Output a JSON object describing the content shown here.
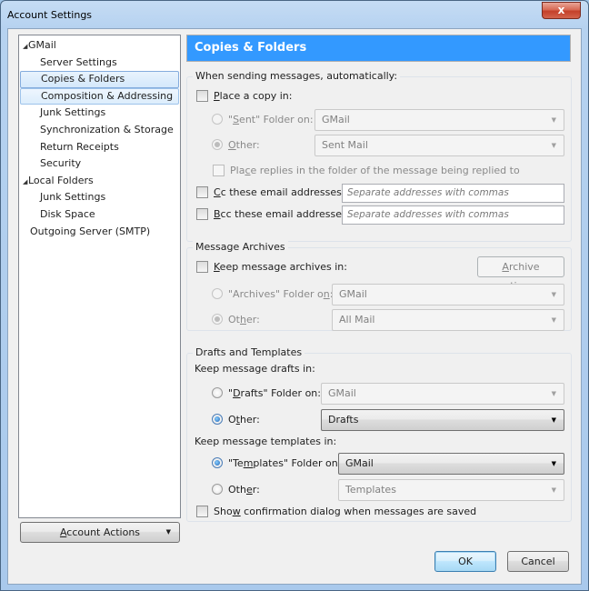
{
  "window": {
    "title": "Account Settings",
    "close_label": "x"
  },
  "sidebar": {
    "items": [
      {
        "label": "GMail",
        "level": 0,
        "expanded": true
      },
      {
        "label": "Server Settings",
        "level": 1
      },
      {
        "label": "Copies & Folders",
        "level": 1,
        "selected": true
      },
      {
        "label": "Composition & Addressing",
        "level": 1,
        "focused": true
      },
      {
        "label": "Junk Settings",
        "level": 1
      },
      {
        "label": "Synchronization & Storage",
        "level": 1
      },
      {
        "label": "Return Receipts",
        "level": 1
      },
      {
        "label": "Security",
        "level": 1
      },
      {
        "label": "Local Folders",
        "level": 0,
        "expanded": true
      },
      {
        "label": "Junk Settings",
        "level": 1
      },
      {
        "label": "Disk Space",
        "level": 1
      },
      {
        "label": "Outgoing Server (SMTP)",
        "level": 0
      }
    ],
    "account_actions": {
      "accel": "A",
      "rest": "ccount Actions"
    }
  },
  "panel": {
    "title": "Copies & Folders",
    "sending": {
      "title": "When sending messages, automatically:",
      "place_copy": {
        "accel": "P",
        "rest": "lace a copy in:",
        "checked": false
      },
      "sent_folder": {
        "pre": "\"",
        "accel": "S",
        "rest": "ent\" Folder on:",
        "value": "GMail",
        "selected": false
      },
      "other": {
        "accel": "O",
        "rest": "ther:",
        "value": "Sent Mail",
        "selected": true
      },
      "place_replies": {
        "pre": "Pla",
        "accel": "c",
        "rest": "e replies in the folder of the message being replied to",
        "checked": false
      },
      "cc": {
        "accel": "C",
        "rest": "c these email addresses:",
        "checked": false,
        "placeholder": "Separate addresses with commas"
      },
      "bcc": {
        "accel": "B",
        "rest": "cc these email addresses:",
        "checked": false,
        "placeholder": "Separate addresses with commas"
      }
    },
    "archives": {
      "title": "Message Archives",
      "keep": {
        "accel": "K",
        "rest": "eep message archives in:",
        "checked": false
      },
      "options_button": {
        "accel": "A",
        "rest": "rchive options..."
      },
      "archives_folder": {
        "pre": "\"Archives\" Folder o",
        "accel": "n",
        "rest": ":",
        "value": "GMail",
        "selected": false
      },
      "other": {
        "pre": "Ot",
        "accel": "h",
        "rest": "er:",
        "value": "All Mail",
        "selected": true
      }
    },
    "drafts": {
      "title": "Drafts and Templates",
      "drafts_label": "Keep message drafts in:",
      "drafts_folder": {
        "pre": "\"",
        "accel": "D",
        "rest": "rafts\" Folder on:",
        "value": "GMail",
        "selected": false
      },
      "drafts_other": {
        "pre": "O",
        "accel": "t",
        "rest": "her:",
        "value": "Drafts",
        "selected": true
      },
      "templates_label": "Keep message templates in:",
      "templates_folder": {
        "pre": "\"Te",
        "accel": "m",
        "rest": "plates\" Folder on:",
        "value": "GMail",
        "selected": true
      },
      "templates_other": {
        "pre": "Oth",
        "accel": "e",
        "rest": "r:",
        "value": "Templates",
        "selected": false
      },
      "show_confirm": {
        "pre": "Sho",
        "accel": "w",
        "rest": " confirmation dialog when messages are saved",
        "checked": false
      }
    }
  },
  "footer": {
    "ok": "OK",
    "cancel": "Cancel"
  }
}
